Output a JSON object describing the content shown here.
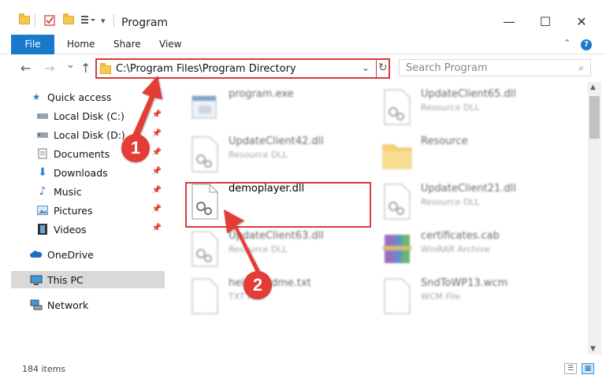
{
  "window": {
    "title": "Program",
    "minimize": "—",
    "maximize": "☐",
    "close": "✕"
  },
  "ribbon": {
    "tabs": [
      "File",
      "Home",
      "Share",
      "View"
    ],
    "help": "?",
    "collapse": "⌃"
  },
  "nav": {
    "back": "←",
    "forward": "→",
    "recent": "⌄",
    "up": "↑",
    "address": "C:\\Program Files\\Program Directory",
    "dropdown": "⌄",
    "refresh": "↻",
    "search_placeholder": "Search Program",
    "search_icon": "⌕"
  },
  "sidebar": {
    "items": [
      {
        "label": "Quick access",
        "icon": "star-icon"
      },
      {
        "label": "Local Disk (C:)",
        "icon": "drive-icon",
        "pinned": true
      },
      {
        "label": "Local Disk (D:)",
        "icon": "drive-icon",
        "pinned": true
      },
      {
        "label": "Documents",
        "icon": "documents-icon",
        "pinned": true
      },
      {
        "label": "Downloads",
        "icon": "downloads-icon",
        "pinned": true
      },
      {
        "label": "Music",
        "icon": "music-icon",
        "pinned": true
      },
      {
        "label": "Pictures",
        "icon": "pictures-icon",
        "pinned": true
      },
      {
        "label": "Videos",
        "icon": "videos-icon",
        "pinned": true
      },
      {
        "label": "OneDrive",
        "icon": "cloud-icon"
      },
      {
        "label": "This PC",
        "icon": "computer-icon",
        "selected": true
      },
      {
        "label": "Network",
        "icon": "network-icon"
      }
    ]
  },
  "files": [
    {
      "name": "program.exe",
      "type": "",
      "icon": "exe-icon"
    },
    {
      "name": "UpdateClient65.dll",
      "type": "Resource DLL",
      "icon": "dll-icon"
    },
    {
      "name": "UpdateClient42.dll",
      "type": "Resource DLL",
      "icon": "dll-icon"
    },
    {
      "name": "Resource",
      "type": "",
      "icon": "folder-icon"
    },
    {
      "name": "demoplayer.dll",
      "type": "",
      "icon": "dll-icon"
    },
    {
      "name": "UpdateClient21.dll",
      "type": "Resource DLL",
      "icon": "dll-icon"
    },
    {
      "name": "UpdateClient63.dll",
      "type": "Resource DLL",
      "icon": "dll-icon"
    },
    {
      "name": "certificates.cab",
      "type": "WinRAR Archive",
      "icon": "archive-icon"
    },
    {
      "name": "help-readme.txt",
      "type": "TXT File",
      "icon": "text-file-icon"
    },
    {
      "name": "SndToWP13.wcm",
      "type": "WCM File",
      "icon": "file-icon"
    }
  ],
  "status": {
    "item_count": "184 items"
  },
  "callouts": [
    "1",
    "2"
  ],
  "colors": {
    "accent": "#1979ca",
    "annotation_red": "#e43c36"
  }
}
